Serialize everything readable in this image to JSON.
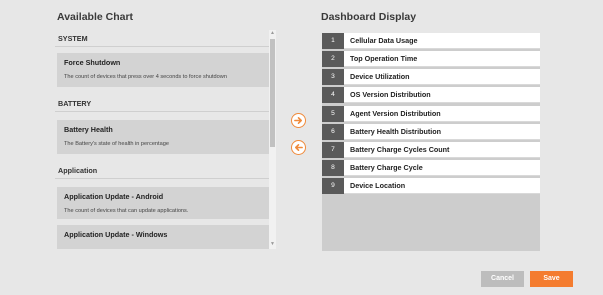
{
  "available": {
    "title": "Available Chart",
    "sections": [
      {
        "label": "SYSTEM",
        "items": [
          {
            "name": "Force Shutdown",
            "desc": "The count of devices that press over 4 seconds to force shutdown"
          }
        ]
      },
      {
        "label": "BATTERY",
        "items": [
          {
            "name": "Battery Health",
            "desc": "The Battery's state of health in percentage"
          }
        ]
      },
      {
        "label": "Application",
        "items": [
          {
            "name": "Application Update - Android",
            "desc": "The count of devices that can update applications."
          },
          {
            "name": "Application Update - Windows",
            "desc": ""
          }
        ]
      }
    ]
  },
  "dashboard": {
    "title": "Dashboard Display",
    "items": [
      {
        "num": "1",
        "label": "Cellular Data Usage"
      },
      {
        "num": "2",
        "label": "Top Operation Time"
      },
      {
        "num": "3",
        "label": "Device Utilization"
      },
      {
        "num": "4",
        "label": "OS Version Distribution"
      },
      {
        "num": "5",
        "label": "Agent Version Distribution"
      },
      {
        "num": "6",
        "label": "Battery Health Distribution"
      },
      {
        "num": "7",
        "label": "Battery Charge Cycles Count"
      },
      {
        "num": "8",
        "label": "Battery Charge Cycle"
      },
      {
        "num": "9",
        "label": "Device Location"
      }
    ]
  },
  "icons": {
    "move_right": "arrow-right-icon",
    "move_left": "arrow-left-icon",
    "scroll_up": "scroll-up-icon",
    "scroll_down": "scroll-down-icon"
  },
  "colors": {
    "accent": "#f47c2f",
    "number_bg": "#5a5a5a",
    "cancel_bg": "#bdbdbd"
  },
  "buttons": {
    "cancel": "Cancel",
    "save": "Save"
  }
}
